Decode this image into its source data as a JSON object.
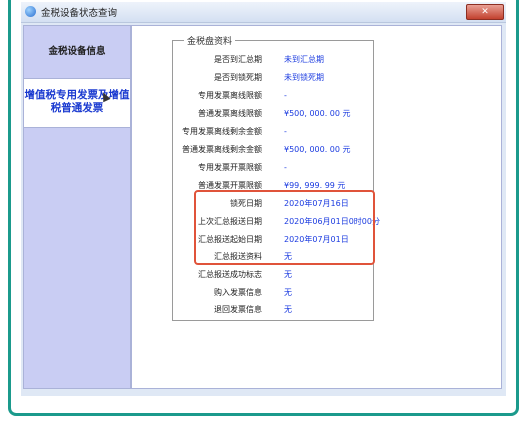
{
  "window": {
    "title": "金税设备状态查询",
    "close_label": "✕"
  },
  "sidebar": {
    "items": [
      {
        "label": "金税设备信息"
      },
      {
        "label": "增值税专用发票及增值税普通发票"
      }
    ]
  },
  "group": {
    "legend": "金税盘资料",
    "rows": [
      {
        "label": "是否到汇总期",
        "value": "未到汇总期"
      },
      {
        "label": "是否到锁死期",
        "value": "未到锁死期"
      },
      {
        "label": "专用发票离线限额",
        "value": "-"
      },
      {
        "label": "普通发票离线限额",
        "value": "¥500, 000. 00 元"
      },
      {
        "label": "专用发票离线剩余金额",
        "value": "-"
      },
      {
        "label": "普通发票离线剩余金额",
        "value": "¥500, 000. 00 元"
      },
      {
        "label": "专用发票开票限额",
        "value": "-"
      },
      {
        "label": "普通发票开票限额",
        "value": "¥99, 999. 99 元"
      },
      {
        "label": "锁死日期",
        "value": "2020年07月16日"
      },
      {
        "label": "上次汇总报送日期",
        "value": "2020年06月01日0时00分"
      },
      {
        "label": "汇总报送起始日期",
        "value": "2020年07月01日"
      },
      {
        "label": "汇总报送资料",
        "value": "无"
      },
      {
        "label": "汇总报送成功标志",
        "value": "无"
      },
      {
        "label": "购入发票信息",
        "value": "无"
      },
      {
        "label": "退回发票信息",
        "value": "无"
      }
    ]
  },
  "colors": {
    "accent_border": "#1b9a8c",
    "value_text": "#1b3be0",
    "highlight_box": "#e0533a"
  }
}
